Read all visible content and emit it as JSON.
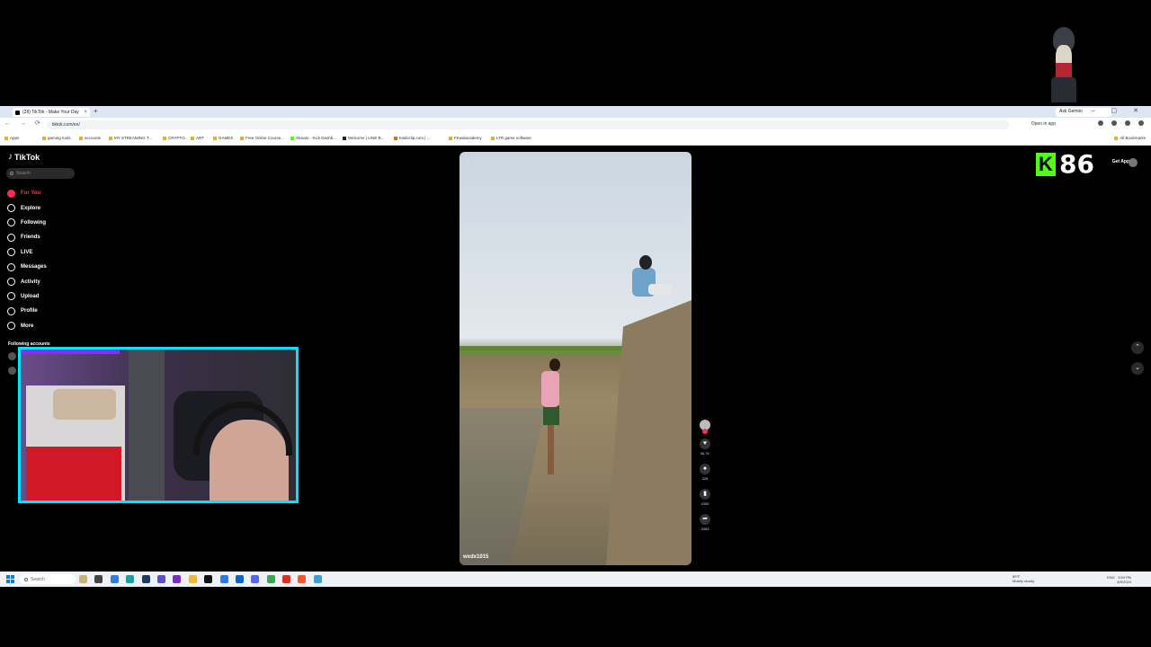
{
  "browser": {
    "tab_title": "(28) TikTok - Make Your Day",
    "tab_close": "×",
    "new_tab": "+",
    "tab2_label": "Ask Gemini",
    "window_controls": "– ▢ ✕",
    "nav_buttons": "← → ⟳",
    "url": "tiktok.com/en/",
    "open_in_app": "Open in app",
    "bookmarks": [
      "Apps",
      "gaming tools",
      "accounts",
      "MY STREAMING T...",
      "CRYPTO",
      "ART",
      "GAMES",
      "Free Online Course...",
      "Stream · Kick Dashb...",
      "Welcome | LINE B...",
      "Kwikiclip.com | ...",
      "FKwalacademy",
      "LTR game software"
    ],
    "all_bookmarks": "All Bookmarks"
  },
  "tiktok": {
    "logo_text": "TikTok",
    "logo_glyph": "♪",
    "search_placeholder": "Search",
    "nav": [
      {
        "label": "For You",
        "icon": "home-icon",
        "active": true
      },
      {
        "label": "Explore",
        "icon": "compass-icon"
      },
      {
        "label": "Following",
        "icon": "following-icon"
      },
      {
        "label": "Friends",
        "icon": "friends-icon"
      },
      {
        "label": "LIVE",
        "icon": "live-icon"
      },
      {
        "label": "Messages",
        "icon": "messages-icon"
      },
      {
        "label": "Activity",
        "icon": "activity-icon"
      },
      {
        "label": "Upload",
        "icon": "upload-icon"
      },
      {
        "label": "Profile",
        "icon": "profile-icon"
      },
      {
        "label": "More",
        "icon": "more-icon"
      }
    ],
    "following_accounts_label": "Following accounts",
    "get_app": "Get App",
    "scroll_up": "⌃",
    "scroll_down": "⌄",
    "video": {
      "username": "wxdx1015",
      "back": "‹"
    },
    "actions": [
      {
        "name": "like",
        "icon": "heart-icon",
        "glyph": "♥",
        "count": "56.7K"
      },
      {
        "name": "comment",
        "icon": "comment-icon",
        "glyph": "●",
        "count": "328"
      },
      {
        "name": "bookmark",
        "icon": "bookmark-icon",
        "glyph": "▮",
        "count": "4355"
      },
      {
        "name": "share",
        "icon": "share-icon",
        "glyph": "➦",
        "count": "3463"
      }
    ],
    "accent_color": "#fe2c55"
  },
  "overlay": {
    "kick_logo": "K",
    "viewer_count": "86",
    "kick_color": "#53fc18",
    "webcam_border_color": "#00e5ff"
  },
  "taskbar": {
    "search_placeholder": "Search",
    "weather_temp": "89°F",
    "weather_desc": "Mostly cloudy",
    "lang": "ENG",
    "time": "3:59 PM",
    "date": "8/5/2024"
  }
}
